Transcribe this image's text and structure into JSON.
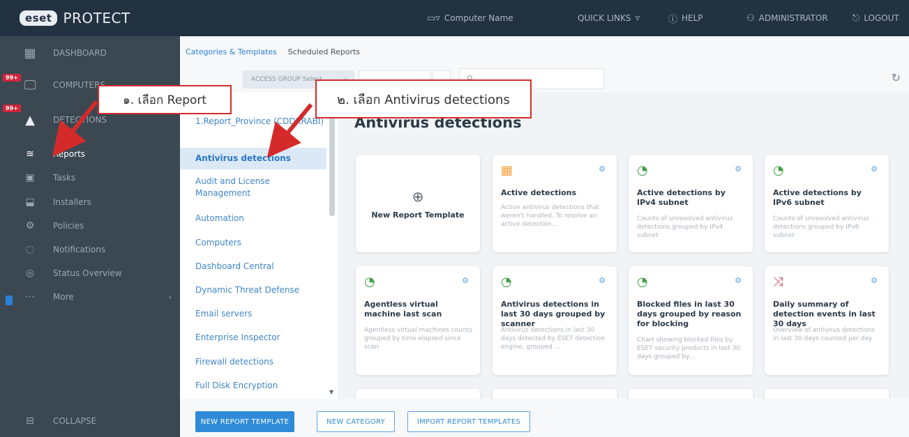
{
  "header": {
    "brand_logo": "eset",
    "product": "PROTECT",
    "computer_name": "Computer Name",
    "quick_links": "QUICK LINKS",
    "help": "HELP",
    "user": "ADMINISTRATOR",
    "logout": "LOGOUT"
  },
  "sidebar": {
    "items": [
      {
        "label": "DASHBOARD",
        "icon": "grid-icon"
      },
      {
        "label": "COMPUTERS",
        "icon": "computers-icon",
        "badge": "99+"
      },
      {
        "label": "DETECTIONS",
        "icon": "warning-icon",
        "badge": "99+"
      },
      {
        "label": "Reports",
        "icon": "reports-icon"
      },
      {
        "label": "Tasks",
        "icon": "tasks-icon"
      },
      {
        "label": "Installers",
        "icon": "installers-icon"
      },
      {
        "label": "Policies",
        "icon": "policies-icon"
      },
      {
        "label": "Notifications",
        "icon": "bell-icon"
      },
      {
        "label": "Status Overview",
        "icon": "status-icon"
      },
      {
        "label": "More",
        "icon": "more-icon"
      }
    ],
    "collapse": "COLLAPSE"
  },
  "subnav": {
    "tab_categories": "Categories & Templates",
    "tab_scheduled": "Scheduled Reports"
  },
  "filter": {
    "access_group": "ACCESS GROUP  Select"
  },
  "categories": [
    "1.Report_Province (CDDKRABI)",
    "Antivirus detections",
    "Audit and License Management",
    "Automation",
    "Computers",
    "Dashboard Central",
    "Dynamic Threat Defense",
    "Email servers",
    "Enterprise Inspector",
    "Firewall detections",
    "Full Disk Encryption"
  ],
  "content": {
    "title": "Antivirus detections",
    "new_template": "New Report Template",
    "cards": [
      {
        "title": "Active detections",
        "desc": "Active antivirus detections that weren't handled. To resolve an active detection...",
        "icon": "table-icon"
      },
      {
        "title": "Active detections by IPv4 subnet",
        "desc": "Counts of unresolved antivirus detections grouped by IPv4 subnet",
        "icon": "pie-chart-icon"
      },
      {
        "title": "Active detections by IPv6 subnet",
        "desc": "Counts of unresolved antivirus detections grouped by IPv6 subnet",
        "icon": "pie-chart-icon"
      },
      {
        "title": "Agentless virtual machine last scan",
        "desc": "Agentless virtual machines counts grouped by time elapsed since scan",
        "icon": "pie-chart-icon"
      },
      {
        "title": "Antivirus detections in last 30 days grouped by scanner",
        "desc": "Antivirus detections in last 30 days detected by ESET detection engine, grouped ...",
        "icon": "pie-chart-icon"
      },
      {
        "title": "Blocked files in last 30 days grouped by reason for blocking",
        "desc": "Chart showing blocked files by ESET security products in last 30 days grouped by...",
        "icon": "pie-chart-icon"
      },
      {
        "title": "Daily summary of detection events in last 30 days",
        "desc": "Overview of antivirus detections in last 30 days counted per day",
        "icon": "line-chart-icon"
      }
    ]
  },
  "footer": {
    "new_report_template": "NEW REPORT TEMPLATE",
    "new_category": "NEW CATEGORY",
    "import": "IMPORT REPORT TEMPLATES"
  },
  "annotations": {
    "step1": "๑. เลือก Report",
    "step2": "๒. เลือก Antivirus detections"
  },
  "colors": {
    "header_bg": "#233240",
    "sidebar_bg": "#3b4852",
    "accent": "#2f8bd8",
    "annotation": "#d42a2a"
  }
}
